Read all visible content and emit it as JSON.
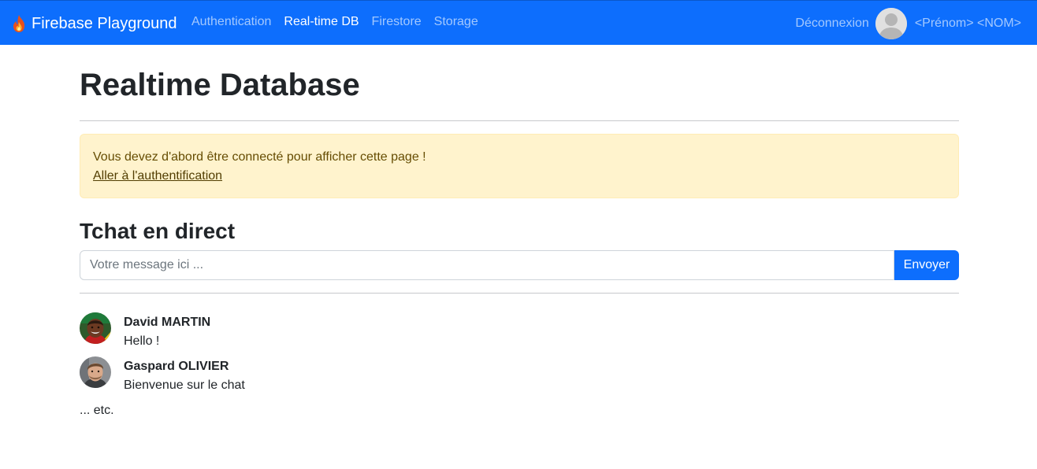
{
  "navbar": {
    "brand_icon": "fire-icon",
    "brand": "Firebase Playground",
    "links": [
      {
        "label": "Authentication",
        "active": false
      },
      {
        "label": "Real-time DB",
        "active": true
      },
      {
        "label": "Firestore",
        "active": false
      },
      {
        "label": "Storage",
        "active": false
      }
    ],
    "logout": "Déconnexion",
    "avatar_icon": "user-avatar-icon",
    "user_name": "<Prénom> <NOM>"
  },
  "page": {
    "title": "Realtime Database"
  },
  "alert": {
    "message": "Vous devez d'abord être connecté pour afficher cette page !",
    "link": "Aller à l'authentification"
  },
  "chat": {
    "title": "Tchat en direct",
    "input_placeholder": "Votre message ici ...",
    "input_value": "",
    "send_label": "Envoyer",
    "messages": [
      {
        "author": "David MARTIN",
        "text": "Hello !",
        "avatar_icon": "user-photo-icon"
      },
      {
        "author": "Gaspard OLIVIER",
        "text": "Bienvenue sur le chat",
        "avatar_icon": "user-photo-icon"
      }
    ],
    "more": "... etc."
  },
  "colors": {
    "primary": "#0d6efd",
    "alert_bg": "#fff3cd",
    "alert_text": "#664d03"
  }
}
